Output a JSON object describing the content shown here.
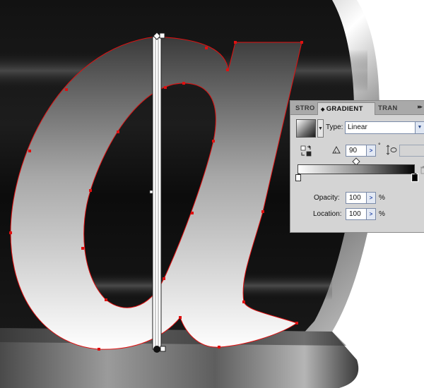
{
  "panel": {
    "tabs": [
      {
        "label": "STRO"
      },
      {
        "label": "GRADIENT"
      },
      {
        "label": "TRAN"
      }
    ],
    "menu_arrows": "▸▸",
    "type_label": "Type:",
    "type_value": "Linear",
    "angle_value": "90",
    "degree_symbol": "°",
    "opacity_label": "Opacity:",
    "opacity_value": "100",
    "opacity_unit": "%",
    "location_label": "Location:",
    "location_value": "100",
    "location_unit": "%"
  },
  "colors": {
    "path_outline": "#e01010",
    "gradient_start": "#ffffff",
    "gradient_end": "#000000"
  }
}
